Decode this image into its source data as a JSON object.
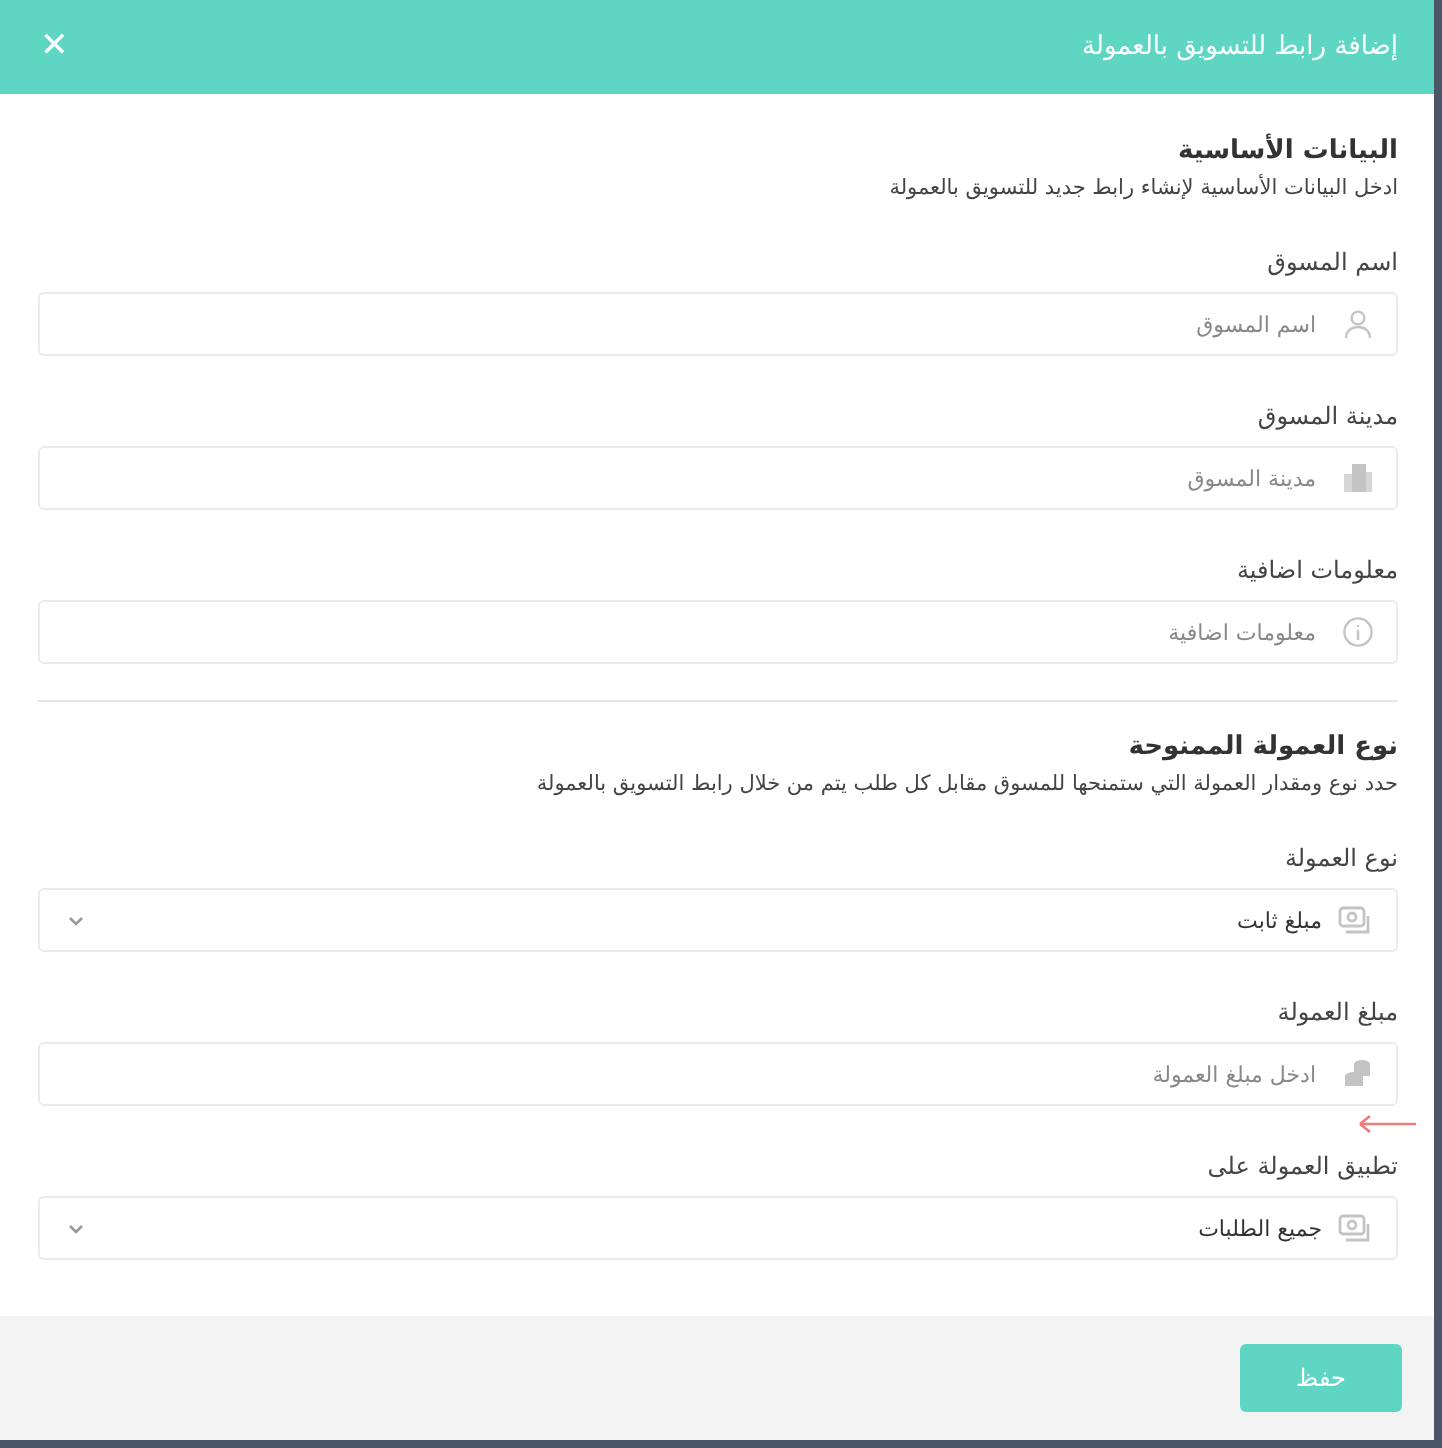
{
  "dialog": {
    "title": "إضافة رابط للتسويق بالعمولة",
    "close": "✕"
  },
  "sections": [
    {
      "title": "البيانات الأساسية",
      "subtitle": "ادخل البيانات الأساسية لإنشاء رابط جديد للتسويق بالعمولة",
      "fields": [
        {
          "label": "اسم المسوق",
          "kind": "text",
          "placeholder": "اسم المسوق"
        },
        {
          "label": "مدينة المسوق",
          "kind": "text",
          "placeholder": "مدينة المسوق"
        },
        {
          "label": "معلومات اضافية",
          "kind": "text",
          "placeholder": "معلومات اضافية"
        }
      ]
    },
    {
      "title": "نوع العمولة الممنوحة",
      "subtitle": "حدد نوع ومقدار العمولة التي ستمنحها للمسوق مقابل كل طلب يتم من خلال رابط التسويق بالعمولة",
      "fields": [
        {
          "label": "نوع العمولة",
          "kind": "select",
          "value": "مبلغ ثابت"
        },
        {
          "label": "مبلغ العمولة",
          "kind": "text",
          "placeholder": "ادخل مبلغ العمولة",
          "annotated": true
        },
        {
          "label": "تطبيق العمولة على",
          "kind": "select",
          "value": "جميع الطلبات"
        }
      ]
    }
  ],
  "footer": {
    "save": "حفظ"
  }
}
